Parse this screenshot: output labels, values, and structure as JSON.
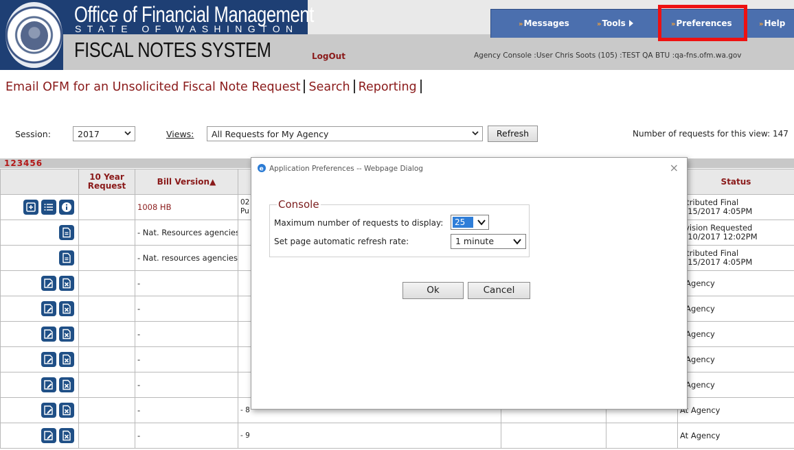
{
  "header": {
    "org_title": "Office of Financial Management",
    "org_subtitle": "STATE OF WASHINGTON",
    "system_title": "FISCAL NOTES SYSTEM",
    "logout_label": "LogOut",
    "agency_info": "Agency Console :User Chris Soots (105) :TEST QA BTU :qa-fns.ofm.wa.gov",
    "nav": {
      "messages": "Messages",
      "tools": "Tools",
      "preferences": "Preferences",
      "help": "Help"
    },
    "highlight_color": "#ee1111"
  },
  "links": {
    "email_ofm": "Email OFM for an Unsolicited Fiscal Note Request",
    "search": "Search",
    "reporting": "Reporting"
  },
  "filters": {
    "session_label": "Session:",
    "session_value": "2017",
    "views_label": "Views:",
    "views_value": "All Requests for My Agency",
    "refresh_label": "Refresh",
    "request_count": "Number of requests for this view: 147"
  },
  "table": {
    "pager": "123456",
    "headers": {
      "ten_year": "10 Year Request",
      "bill_version": "Bill Version",
      "status": "Status"
    },
    "rows": [
      {
        "bill": "1008 HB",
        "mid": "02\nPu",
        "status": "istributed Final\n2/15/2017 4:05PM",
        "icons": [
          "add",
          "list",
          "info"
        ]
      },
      {
        "bill": "- Nat. Resources agencies/",
        "mid": "",
        "status": "evision Requested\n2/10/2017 12:02PM",
        "icons": [
          "doc"
        ]
      },
      {
        "bill": "- Nat. resources agencies",
        "mid": "",
        "status": "istributed Final\n2/15/2017 4:05PM",
        "icons": [
          "doc"
        ]
      },
      {
        "bill": "-",
        "mid": "",
        "status": "t Agency",
        "icons": [
          "edit",
          "delete"
        ]
      },
      {
        "bill": "-",
        "mid": "",
        "status": "t Agency",
        "icons": [
          "edit",
          "delete"
        ]
      },
      {
        "bill": "-",
        "mid": "",
        "status": "t Agency",
        "icons": [
          "edit",
          "delete"
        ]
      },
      {
        "bill": "-",
        "mid": "",
        "status": "t Agency",
        "icons": [
          "edit",
          "delete"
        ]
      },
      {
        "bill": "-",
        "mid": "",
        "status": "t Agency",
        "icons": [
          "edit",
          "delete"
        ]
      },
      {
        "bill": "-",
        "mid": "- 8",
        "status": "At Agency",
        "icons": [
          "edit",
          "delete"
        ]
      },
      {
        "bill": "-",
        "mid": "- 9",
        "status": "At Agency",
        "icons": [
          "edit",
          "delete"
        ]
      }
    ]
  },
  "dialog": {
    "title": "Application Preferences -- Webpage Dialog",
    "close": "×",
    "legend": "Console",
    "max_label": "Maximum number of requests to display:",
    "max_value": "25",
    "refresh_label": "Set page automatic refresh rate:",
    "refresh_value": "1 minute",
    "ok": "Ok",
    "cancel": "Cancel"
  }
}
